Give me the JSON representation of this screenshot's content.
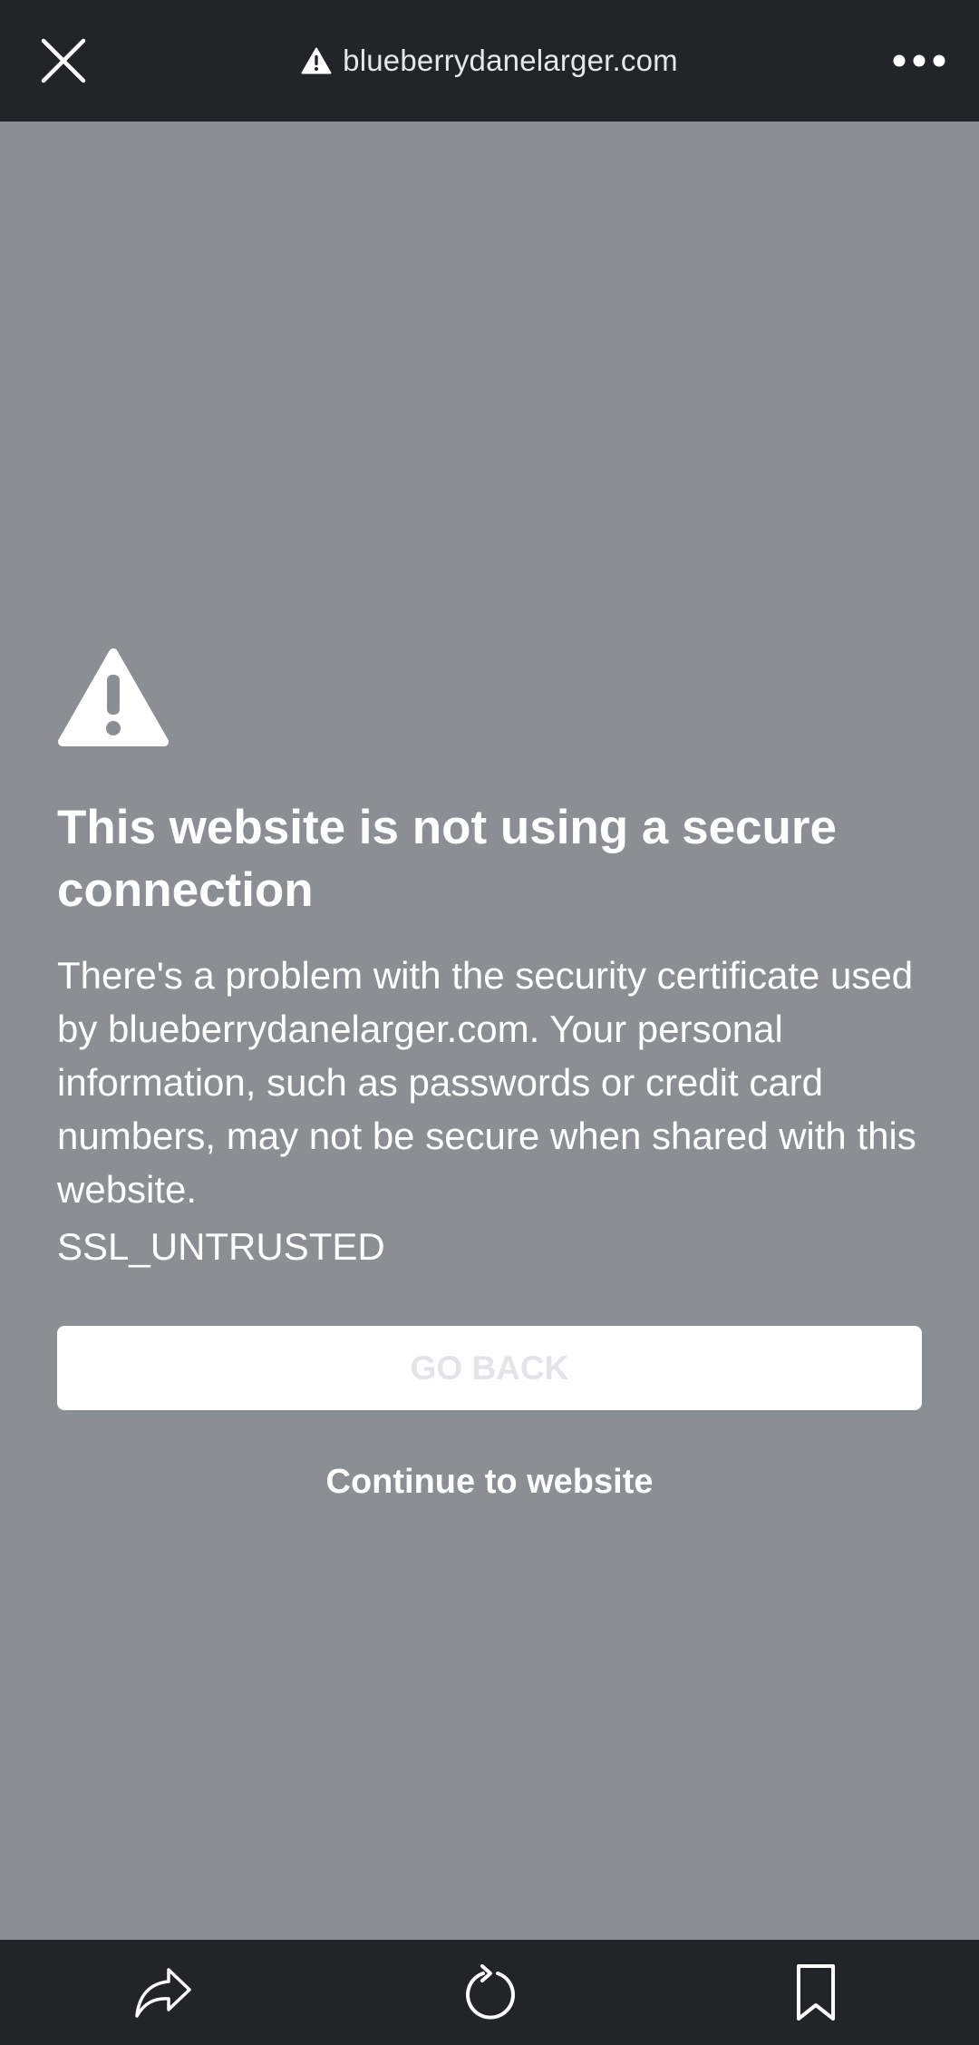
{
  "browser": {
    "url": "blueberrydanelarger.com",
    "close_icon": "close-icon",
    "url_warning_icon": "warning-triangle-icon",
    "more_icon": "more-horizontal-icon"
  },
  "warning": {
    "icon": "warning-triangle-icon",
    "title": "This website is not using a secure connection",
    "body": "There's a problem with the security certificate used by blueberrydanelarger.com. Your personal information, such as passwords or credit card numbers, may not be secure when shared with this website.",
    "error_code": "SSL_UNTRUSTED",
    "go_back_label": "GO BACK",
    "continue_label": "Continue to website"
  },
  "toolbar": {
    "share_icon": "share-icon",
    "refresh_icon": "refresh-icon",
    "bookmark_icon": "bookmark-icon"
  },
  "colors": {
    "bar_background": "#232427",
    "page_background": "#8b8e93",
    "text": "#ffffff",
    "button_background": "#ffffff",
    "button_text": "#e3e4e7"
  }
}
